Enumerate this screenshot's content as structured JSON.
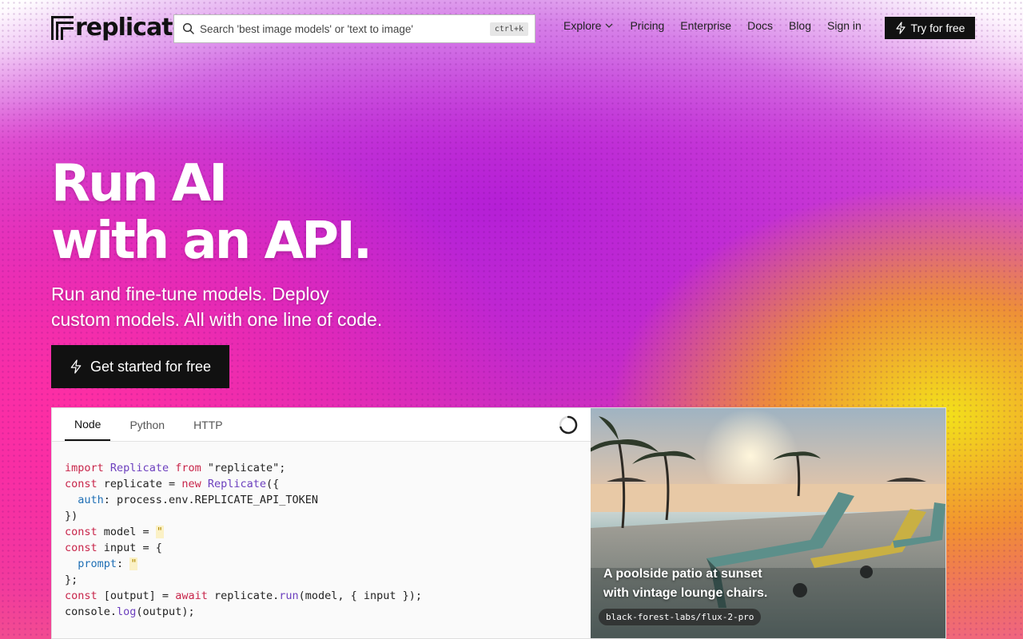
{
  "nav": {
    "logo_text": "replicate",
    "search_placeholder": "Search 'best image models' or 'text to image'",
    "search_shortcut": "ctrl+k",
    "links": [
      {
        "label": "Explore"
      },
      {
        "label": "Pricing"
      },
      {
        "label": "Enterprise"
      },
      {
        "label": "Docs"
      },
      {
        "label": "Blog"
      },
      {
        "label": "Sign in"
      }
    ],
    "try_button": "Try for free"
  },
  "hero": {
    "title_line1": "Run AI",
    "title_line2": "with an API.",
    "subtitle_line1": "Run and fine-tune models. Deploy",
    "subtitle_line2": "custom models. All with one line of code.",
    "cta_label": "Get started for free"
  },
  "code_panel": {
    "tabs": [
      {
        "label": "Node",
        "active": true
      },
      {
        "label": "Python",
        "active": false
      },
      {
        "label": "HTTP",
        "active": false
      }
    ],
    "lines": [
      "import Replicate from \"replicate\";",
      "const replicate = new Replicate({",
      "  auth: process.env.REPLICATE_API_TOKEN",
      "})",
      "const model = \"\"",
      "const input = {",
      "  prompt: \"\"",
      "};",
      "const [output] = await replicate.run(model, { input });",
      "console.log(output);"
    ]
  },
  "example": {
    "caption": "A poolside patio at sunset with vintage lounge chairs.",
    "model": "black-forest-labs/flux-2-pro"
  }
}
